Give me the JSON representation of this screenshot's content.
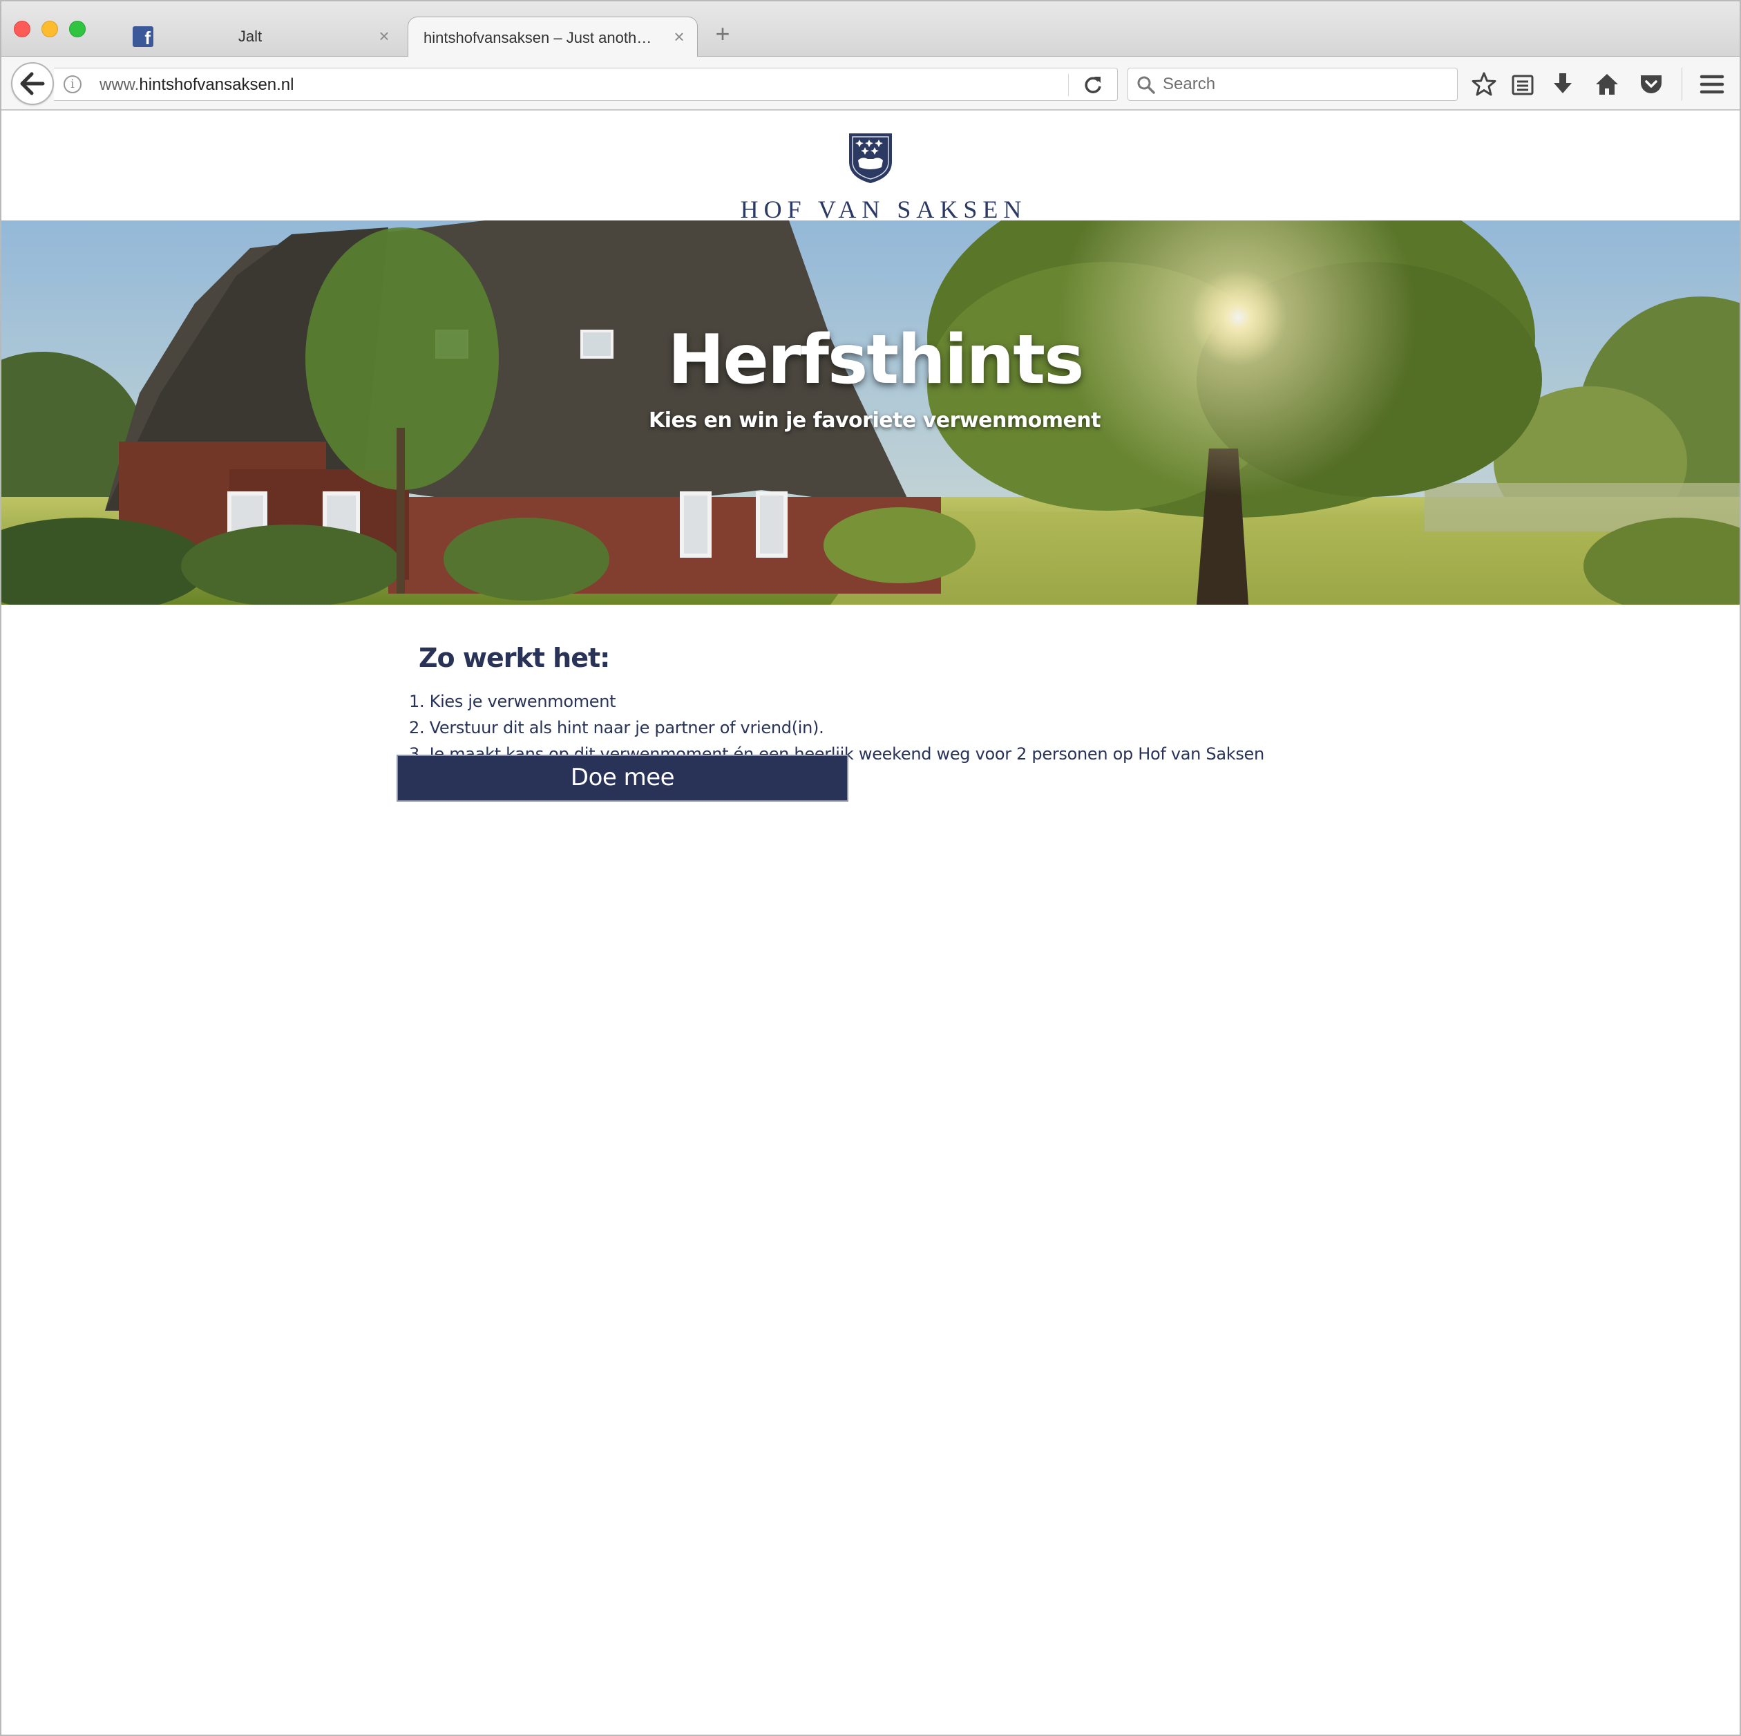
{
  "browser": {
    "tabs": [
      {
        "title": "Jalt",
        "icon": "facebook-icon",
        "active": false
      },
      {
        "title": "hintshofvansaksen – Just anoth…",
        "active": true
      }
    ],
    "url_prefix": "www.",
    "url_domain": "hintshofvansaksen.nl",
    "search_placeholder": "Search"
  },
  "site": {
    "logo_text": "HOF VAN SAKSEN"
  },
  "hero": {
    "title": "Herfsthints",
    "subtitle": "Kies en win je favoriete verwenmoment"
  },
  "how_it_works": {
    "title": "Zo werkt het:",
    "steps": [
      "1. Kies je verwenmoment",
      "2. Verstuur dit als hint naar je partner of vriend(in).",
      "3. Je maakt kans op dit verwenmoment én een heerlijk weekend weg voor 2 personen op Hof van Saksen"
    ],
    "button_label": "Doe mee"
  },
  "colors": {
    "brand_navy": "#293358",
    "chrome_bg": "#f6f6f6"
  }
}
